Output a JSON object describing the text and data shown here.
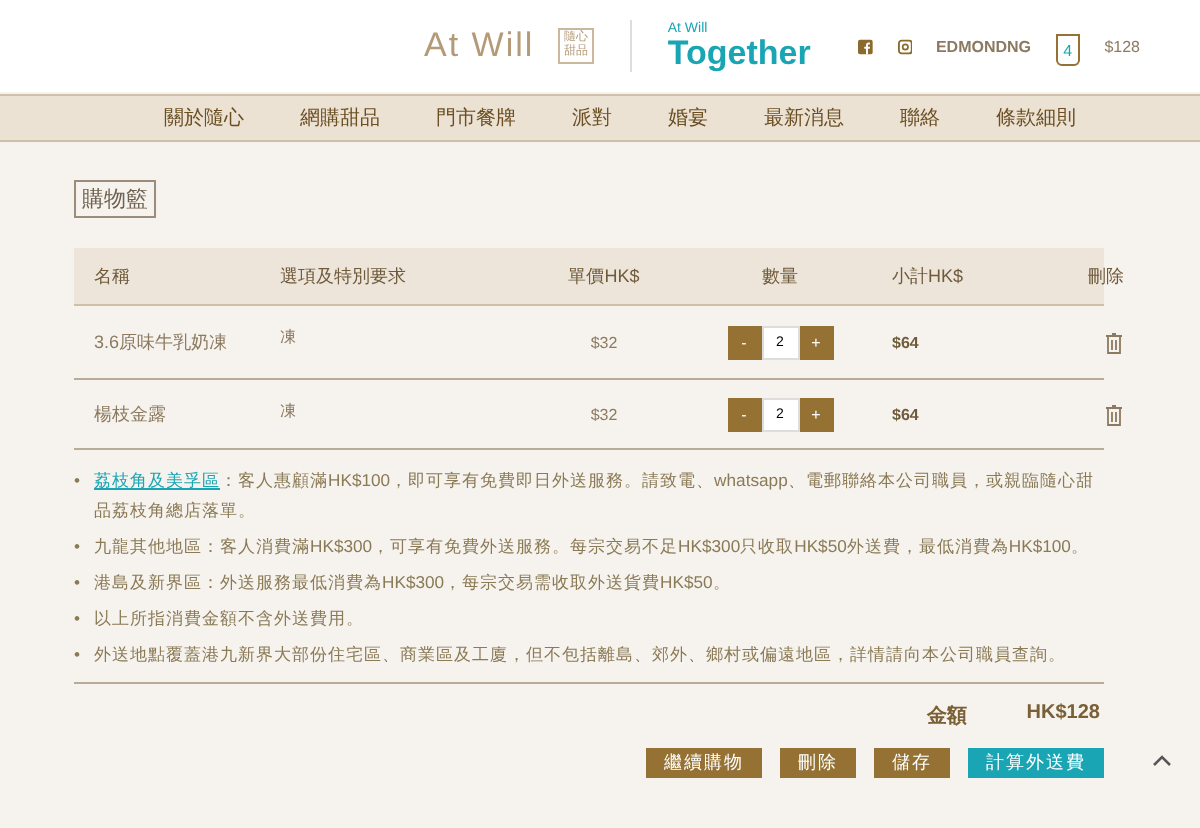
{
  "header": {
    "brand": "At Will",
    "brand_badge": [
      "隨心",
      "甜品"
    ],
    "partner_small": "At Will",
    "partner_big": "Together",
    "user": "EDMONDNG",
    "cart_count": "4",
    "cart_total": "$128"
  },
  "nav": [
    "關於隨心",
    "網購甜品",
    "門市餐牌",
    "派對",
    "婚宴",
    "最新消息",
    "聯絡",
    "條款細則"
  ],
  "page_title": "購物籃",
  "table": {
    "columns": [
      "名稱",
      "選項及特別要求",
      "單價HK$",
      "數量",
      "小計HK$",
      "刪除"
    ],
    "rows": [
      {
        "name": "3.6原味牛乳奶凍",
        "option": "凍",
        "price": "$32",
        "qty_minus": "-",
        "qty": "2",
        "qty_plus": "+",
        "subtotal": "$64"
      },
      {
        "name": "楊枝金露",
        "option": "凍",
        "price": "$32",
        "qty_minus": "-",
        "qty": "2",
        "qty_plus": "+",
        "subtotal": "$64"
      }
    ]
  },
  "notes": [
    {
      "marker": "•",
      "link": "荔枝角及美孚區",
      "text": "：客人惠顧滿HK$100，即可享有免費即日外送服務。請致電、whatsapp、電郵聯絡本公司職員，或親臨隨心甜品荔枝角總店落單。"
    },
    {
      "marker": "•",
      "text": "九龍其他地區：客人消費滿HK$300，可享有免費外送服務。每宗交易不足HK$300只收取HK$50外送費，最低消費為HK$100。"
    },
    {
      "marker": "•",
      "text": "港島及新界區：外送服務最低消費為HK$300，每宗交易需收取外送貨費HK$50。"
    },
    {
      "marker": "•",
      "text": "以上所指消費金額不含外送費用。"
    },
    {
      "marker": "•",
      "text": "外送地點覆蓋港九新界大部份住宅區、商業區及工廈，但不包括離島、郊外、鄉村或偏遠地區，詳情請向本公司職員查詢。"
    }
  ],
  "total": {
    "label": "金額",
    "value": "HK$128"
  },
  "buttons": [
    {
      "label": "繼續購物",
      "kind": "normal"
    },
    {
      "label": "刪除",
      "kind": "normal"
    },
    {
      "label": "儲存",
      "kind": "normal"
    },
    {
      "label": "計算外送費",
      "kind": "primary"
    }
  ]
}
